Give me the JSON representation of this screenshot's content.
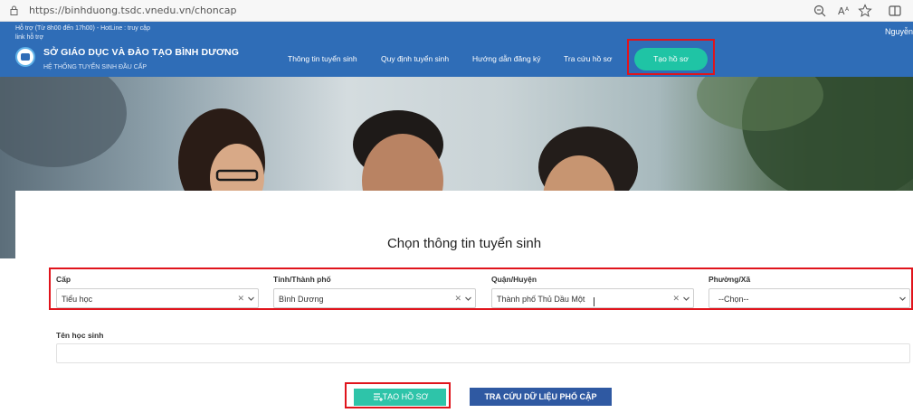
{
  "browser": {
    "url": "https://binhduong.tsdc.vnedu.vn/choncap"
  },
  "header": {
    "support": "Hỗ trợ (Từ 8h00 đến 17h00) - HotLine : truy cập link hỗ trợ",
    "user": "Nguyễn",
    "title": "SỞ GIÁO DỤC VÀ ĐÀO TẠO BÌNH DƯƠNG",
    "subtitle": "HỆ THỐNG TUYỂN SINH ĐẦU CẤP",
    "nav": [
      "Thông tin tuyển sinh",
      "Quy định tuyển sinh",
      "Hướng dẫn đăng ký",
      "Tra cứu hồ sơ"
    ],
    "cta": "Tạo hồ sơ"
  },
  "form": {
    "title": "Chọn thông tin tuyển sinh",
    "fields": [
      {
        "label": "Cấp",
        "value": "Tiểu học"
      },
      {
        "label": "Tỉnh/Thành phố",
        "value": "Bình Dương"
      },
      {
        "label": "Quận/Huyện",
        "value": "Thành phố Thủ Dầu Một"
      },
      {
        "label": "Phường/Xã",
        "value": "--Chọn--"
      }
    ],
    "student_label": "Tên học sinh",
    "student_value": "",
    "create_button": "TẠO HỒ SƠ",
    "lookup_button": "TRA CỨU DỮ LIỆU PHỔ CẬP"
  },
  "colors": {
    "header_blue": "#2f6db7",
    "accent_green": "#1fc4a5",
    "lookup_blue": "#2f59a2",
    "highlight_red": "#e0141c"
  }
}
